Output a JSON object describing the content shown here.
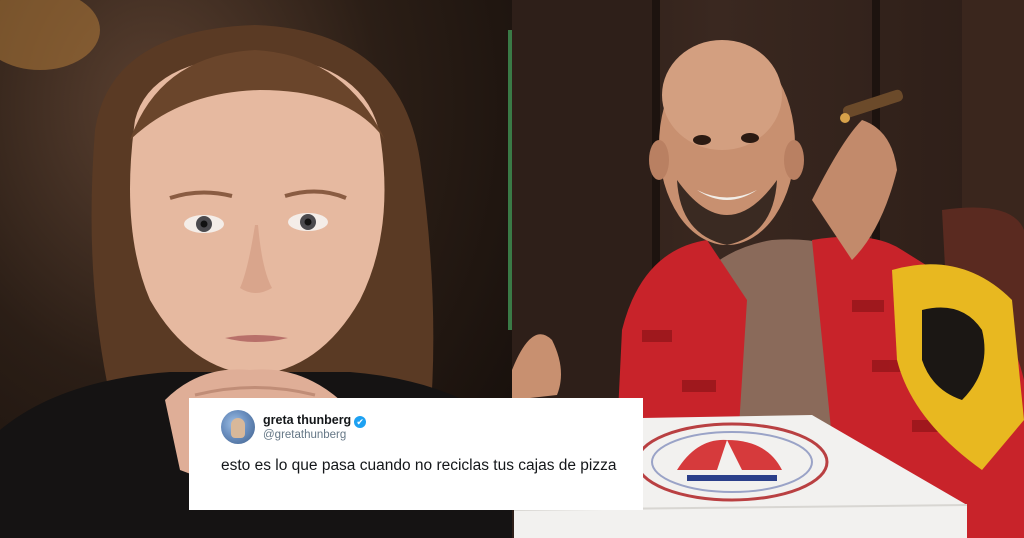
{
  "tweet": {
    "display_name": "greta thunberg",
    "handle": "@gretathunberg",
    "text": "esto es lo que pasa cuando no reciclas tus cajas de pizza",
    "verified_icon": "✔"
  },
  "left_photo": {
    "subject": "girl-with-clasped-hands"
  },
  "right_photo": {
    "subject": "bald-man-red-robe-cigar-pizza-box"
  },
  "colors": {
    "verified_blue": "#1da1f2",
    "robe_red": "#c8232a",
    "flag_yellow": "#e8b820",
    "divider_green": "#3a7a46"
  }
}
